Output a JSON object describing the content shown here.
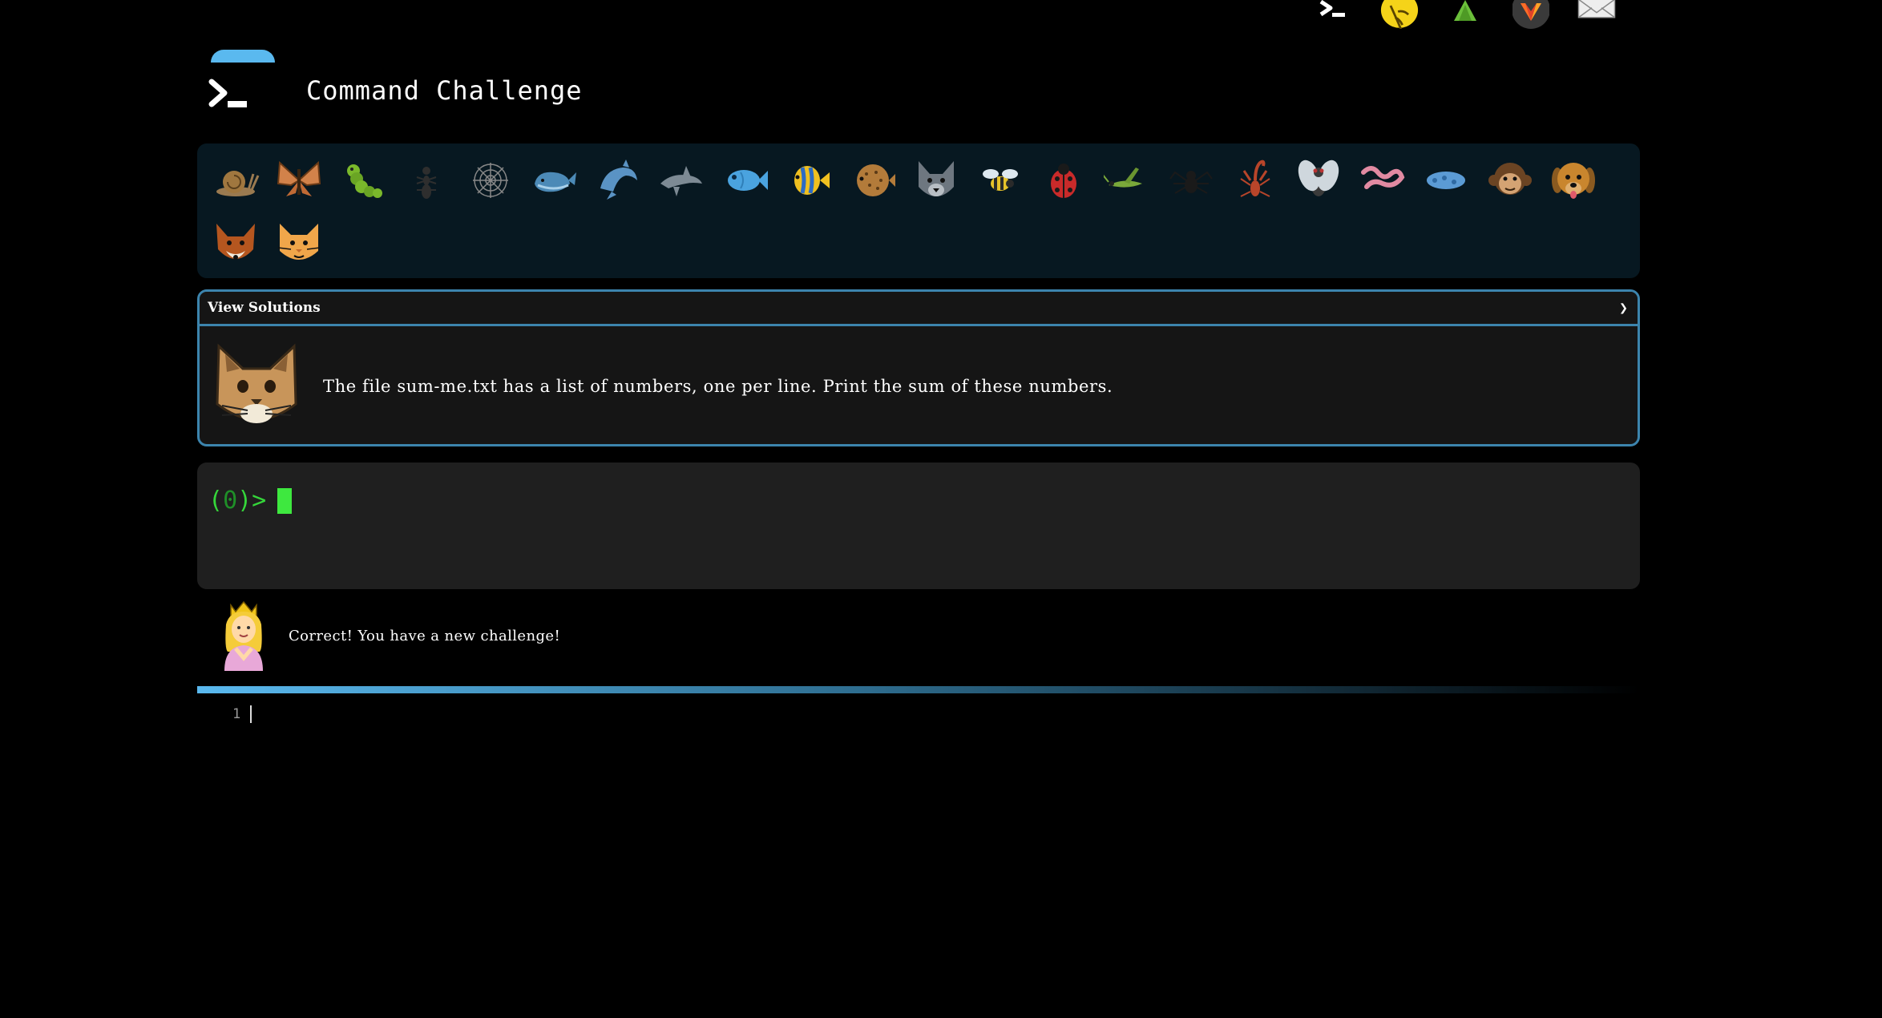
{
  "top_nav": {
    "items": [
      {
        "name": "terminal-icon"
      },
      {
        "name": "lightbulb-hand-icon"
      },
      {
        "name": "tree-icon"
      },
      {
        "name": "gitlab-icon"
      },
      {
        "name": "mail-icon"
      }
    ]
  },
  "header": {
    "title": "Command Challenge",
    "logo": "terminal-prompt-icon",
    "accent": "#5ab9ef"
  },
  "animals": [
    "snail",
    "butterfly",
    "caterpillar",
    "ant",
    "spider-web",
    "whale",
    "dolphin-blue",
    "dolphin-grey",
    "fish",
    "tropical-fish",
    "blowfish",
    "wolf",
    "bee",
    "ladybug",
    "cricket",
    "spider",
    "scorpion",
    "fly",
    "worm",
    "microbe",
    "monkey",
    "dog",
    "fox",
    "cat"
  ],
  "challenge": {
    "solutions_label": "View Solutions",
    "chevron": "❯",
    "avatar": "cat-face-icon",
    "text": "The file sum-me.txt has a list of numbers, one per line. Print the sum of these numbers."
  },
  "terminal": {
    "prompt_open": "(",
    "prompt_count": "0",
    "prompt_close": ")>",
    "prompt_color": "#35d63a"
  },
  "feedback": {
    "avatar": "princess-icon",
    "text": "Correct! You have a new challenge!"
  },
  "editor": {
    "line_number": "1"
  },
  "colors": {
    "background": "#000000",
    "panel": "#071821",
    "border": "#3c84ad",
    "terminal_bg": "#1f1f1f"
  }
}
